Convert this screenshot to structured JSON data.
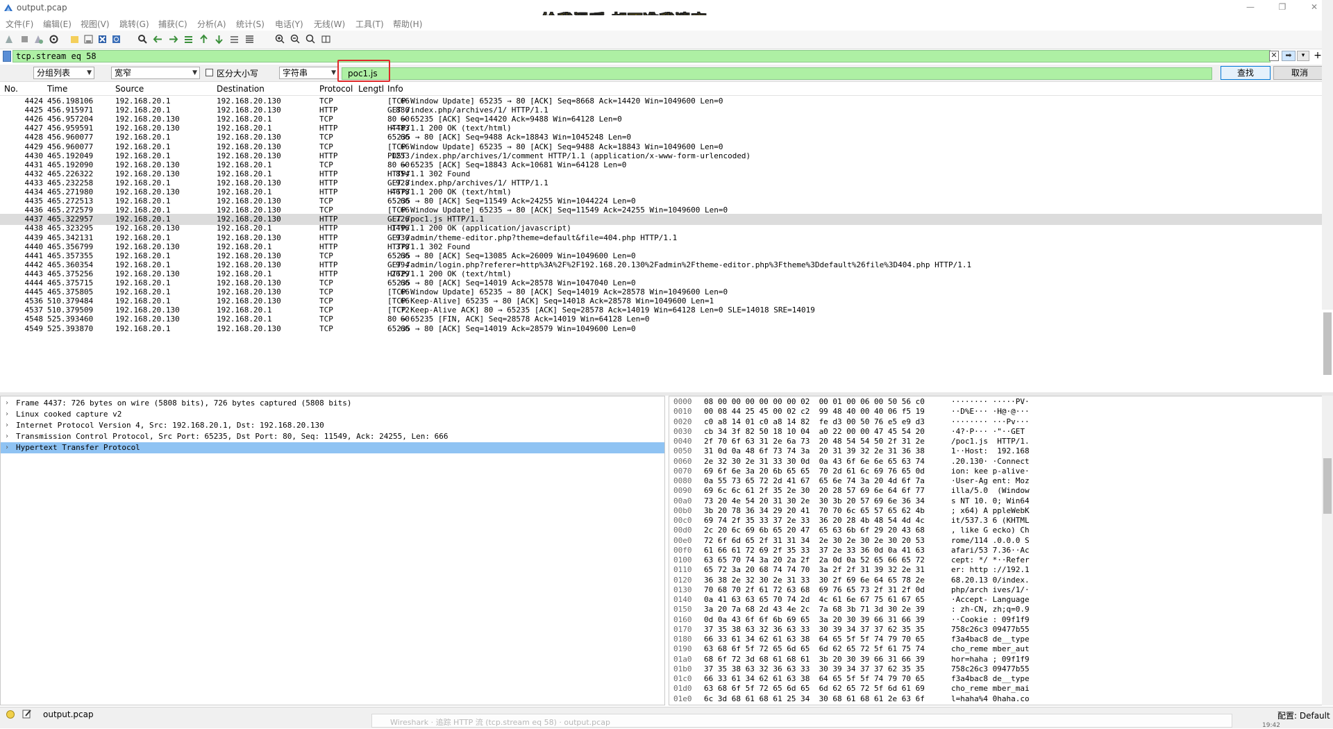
{
  "window": {
    "title": "output.pcap",
    "caption_overlay": "给我温暖 却不准我遗忘",
    "minimize": "—",
    "maximize": "❐",
    "close": "✕"
  },
  "menu": [
    "文件(F)",
    "编辑(E)",
    "视图(V)",
    "跳转(G)",
    "捕获(C)",
    "分析(A)",
    "统计(S)",
    "电话(Y)",
    "无线(W)",
    "工具(T)",
    "帮助(H)"
  ],
  "filter": {
    "value": "tcp.stream eq 58",
    "clear_label": "✕",
    "apply_label": "➡",
    "dropdown_label": "▾",
    "add_label": "+"
  },
  "find": {
    "scope": "分组列表",
    "width": "宽窄",
    "case_label": "区分大小写",
    "type": "字符串",
    "value": "poc1.js",
    "find_label": "查找",
    "cancel_label": "取消"
  },
  "columns": [
    "No.",
    "Time",
    "Source",
    "Destination",
    "Protocol",
    "Lengtl",
    "Info"
  ],
  "packets": [
    {
      "no": "4424",
      "time": "456.198106",
      "src": "192.168.20.1",
      "dst": "192.168.20.130",
      "proto": "TCP",
      "len": "66",
      "info": "[TCP Window Update] 65235 → 80 [ACK] Seq=8668 Ack=14420 Win=1049600 Len=0"
    },
    {
      "no": "4425",
      "time": "456.915971",
      "src": "192.168.20.1",
      "dst": "192.168.20.130",
      "proto": "HTTP",
      "len": "880",
      "info": "GET /index.php/archives/1/ HTTP/1.1"
    },
    {
      "no": "4426",
      "time": "456.957204",
      "src": "192.168.20.130",
      "dst": "192.168.20.1",
      "proto": "TCP",
      "len": "60",
      "info": "80 → 65235 [ACK] Seq=14420 Ack=9488 Win=64128 Len=0"
    },
    {
      "no": "4427",
      "time": "456.959591",
      "src": "192.168.20.130",
      "dst": "192.168.20.1",
      "proto": "HTTP",
      "len": "4483",
      "info": "HTTP/1.1 200 OK  (text/html)"
    },
    {
      "no": "4428",
      "time": "456.960077",
      "src": "192.168.20.1",
      "dst": "192.168.20.130",
      "proto": "TCP",
      "len": "66",
      "info": "65235 → 80 [ACK] Seq=9488 Ack=18843 Win=1045248 Len=0"
    },
    {
      "no": "4429",
      "time": "456.960077",
      "src": "192.168.20.1",
      "dst": "192.168.20.130",
      "proto": "TCP",
      "len": "66",
      "info": "[TCP Window Update] 65235 → 80 [ACK] Seq=9488 Ack=18843 Win=1049600 Len=0"
    },
    {
      "no": "4430",
      "time": "465.192049",
      "src": "192.168.20.1",
      "dst": "192.168.20.130",
      "proto": "HTTP",
      "len": "1253",
      "info": "POST /index.php/archives/1/comment HTTP/1.1  (application/x-www-form-urlencoded)"
    },
    {
      "no": "4431",
      "time": "465.192090",
      "src": "192.168.20.130",
      "dst": "192.168.20.1",
      "proto": "TCP",
      "len": "60",
      "info": "80 → 65235 [ACK] Seq=18843 Ack=10681 Win=64128 Len=0"
    },
    {
      "no": "4432",
      "time": "465.226322",
      "src": "192.168.20.130",
      "dst": "192.168.20.1",
      "proto": "HTTP",
      "len": "854",
      "info": "HTTP/1.1 302 Found"
    },
    {
      "no": "4433",
      "time": "465.232258",
      "src": "192.168.20.1",
      "dst": "192.168.20.130",
      "proto": "HTTP",
      "len": "928",
      "info": "GET /index.php/archives/1/ HTTP/1.1"
    },
    {
      "no": "4434",
      "time": "465.271980",
      "src": "192.168.20.130",
      "dst": "192.168.20.1",
      "proto": "HTTP",
      "len": "4678",
      "info": "HTTP/1.1 200 OK  (text/html)"
    },
    {
      "no": "4435",
      "time": "465.272513",
      "src": "192.168.20.1",
      "dst": "192.168.20.130",
      "proto": "TCP",
      "len": "66",
      "info": "65235 → 80 [ACK] Seq=11549 Ack=24255 Win=1044224 Len=0"
    },
    {
      "no": "4436",
      "time": "465.272579",
      "src": "192.168.20.1",
      "dst": "192.168.20.130",
      "proto": "TCP",
      "len": "66",
      "info": "[TCP Window Update] 65235 → 80 [ACK] Seq=11549 Ack=24255 Win=1049600 Len=0"
    },
    {
      "no": "4437",
      "time": "465.322957",
      "src": "192.168.20.1",
      "dst": "192.168.20.130",
      "proto": "HTTP",
      "len": "726",
      "info": "GET /poc1.js HTTP/1.1",
      "selected": true
    },
    {
      "no": "4438",
      "time": "465.323295",
      "src": "192.168.20.130",
      "dst": "192.168.20.1",
      "proto": "HTTP",
      "len": "1496",
      "info": "HTTP/1.1 200 OK  (application/javascript)"
    },
    {
      "no": "4439",
      "time": "465.342131",
      "src": "192.168.20.1",
      "dst": "192.168.20.130",
      "proto": "HTTP",
      "len": "930",
      "info": "GET /admin/theme-editor.php?theme=default&file=404.php HTTP/1.1"
    },
    {
      "no": "4440",
      "time": "465.356799",
      "src": "192.168.20.130",
      "dst": "192.168.20.1",
      "proto": "HTTP",
      "len": "378",
      "info": "HTTP/1.1 302 Found"
    },
    {
      "no": "4441",
      "time": "465.357355",
      "src": "192.168.20.1",
      "dst": "192.168.20.130",
      "proto": "TCP",
      "len": "66",
      "info": "65235 → 80 [ACK] Seq=13085 Ack=26009 Win=1049600 Len=0"
    },
    {
      "no": "4442",
      "time": "465.360354",
      "src": "192.168.20.1",
      "dst": "192.168.20.130",
      "proto": "HTTP",
      "len": "994",
      "info": "GET /admin/login.php?referer=http%3A%2F%2F192.168.20.130%2Fadmin%2Ftheme-editor.php%3Ftheme%3Ddefault%26file%3D404.php HTTP/1.1"
    },
    {
      "no": "4443",
      "time": "465.375256",
      "src": "192.168.20.130",
      "dst": "192.168.20.1",
      "proto": "HTTP",
      "len": "2629",
      "info": "HTTP/1.1 200 OK  (text/html)"
    },
    {
      "no": "4444",
      "time": "465.375715",
      "src": "192.168.20.1",
      "dst": "192.168.20.130",
      "proto": "TCP",
      "len": "66",
      "info": "65235 → 80 [ACK] Seq=14019 Ack=28578 Win=1047040 Len=0"
    },
    {
      "no": "4445",
      "time": "465.375805",
      "src": "192.168.20.1",
      "dst": "192.168.20.130",
      "proto": "TCP",
      "len": "66",
      "info": "[TCP Window Update] 65235 → 80 [ACK] Seq=14019 Ack=28578 Win=1049600 Len=0"
    },
    {
      "no": "4536",
      "time": "510.379484",
      "src": "192.168.20.1",
      "dst": "192.168.20.130",
      "proto": "TCP",
      "len": "66",
      "info": "[TCP Keep-Alive] 65235 → 80 [ACK] Seq=14018 Ack=28578 Win=1049600 Len=1"
    },
    {
      "no": "4537",
      "time": "510.379509",
      "src": "192.168.20.130",
      "dst": "192.168.20.1",
      "proto": "TCP",
      "len": "72",
      "info": "[TCP Keep-Alive ACK] 80 → 65235 [ACK] Seq=28578 Ack=14019 Win=64128 Len=0 SLE=14018 SRE=14019"
    },
    {
      "no": "4548",
      "time": "525.393460",
      "src": "192.168.20.130",
      "dst": "192.168.20.1",
      "proto": "TCP",
      "len": "60",
      "info": "80 → 65235 [FIN, ACK] Seq=28578 Ack=14019 Win=64128 Len=0"
    },
    {
      "no": "4549",
      "time": "525.393870",
      "src": "192.168.20.1",
      "dst": "192.168.20.130",
      "proto": "TCP",
      "len": "66",
      "info": "65235 → 80 [ACK] Seq=14019 Ack=28579 Win=1049600 Len=0"
    }
  ],
  "details": [
    {
      "text": "Frame 4437: 726 bytes on wire (5808 bits), 726 bytes captured (5808 bits)"
    },
    {
      "text": "Linux cooked capture v2"
    },
    {
      "text": "Internet Protocol Version 4, Src: 192.168.20.1, Dst: 192.168.20.130"
    },
    {
      "text": "Transmission Control Protocol, Src Port: 65235, Dst Port: 80, Seq: 11549, Ack: 24255, Len: 666"
    },
    {
      "text": "Hypertext Transfer Protocol",
      "selected": true
    }
  ],
  "bytes": [
    {
      "off": "0000",
      "hex": "08 00 00 00 00 00 00 02  00 01 00 06 00 50 56 c0",
      "ascii": "········ ·····PV·"
    },
    {
      "off": "0010",
      "hex": "00 08 44 25 45 00 02 c2  99 48 40 00 40 06 f5 19",
      "ascii": "··D%E··· ·H@·@···"
    },
    {
      "off": "0020",
      "hex": "c0 a8 14 01 c0 a8 14 82  fe d3 00 50 76 e5 e9 d3",
      "ascii": "········ ···Pv···"
    },
    {
      "off": "0030",
      "hex": "cb 34 3f 82 50 18 10 04  a0 22 00 00 47 45 54 20",
      "ascii": "·4?·P··· ·\"··GET "
    },
    {
      "off": "0040",
      "hex": "2f 70 6f 63 31 2e 6a 73  20 48 54 54 50 2f 31 2e",
      "ascii": "/poc1.js  HTTP/1."
    },
    {
      "off": "0050",
      "hex": "31 0d 0a 48 6f 73 74 3a  20 31 39 32 2e 31 36 38",
      "ascii": "1··Host:  192.168"
    },
    {
      "off": "0060",
      "hex": "2e 32 30 2e 31 33 30 0d  0a 43 6f 6e 6e 65 63 74",
      "ascii": ".20.130· ·Connect"
    },
    {
      "off": "0070",
      "hex": "69 6f 6e 3a 20 6b 65 65  70 2d 61 6c 69 76 65 0d",
      "ascii": "ion: kee p-alive·"
    },
    {
      "off": "0080",
      "hex": "0a 55 73 65 72 2d 41 67  65 6e 74 3a 20 4d 6f 7a",
      "ascii": "·User-Ag ent: Moz"
    },
    {
      "off": "0090",
      "hex": "69 6c 6c 61 2f 35 2e 30  20 28 57 69 6e 64 6f 77",
      "ascii": "illa/5.0  (Window"
    },
    {
      "off": "00a0",
      "hex": "73 20 4e 54 20 31 30 2e  30 3b 20 57 69 6e 36 34",
      "ascii": "s NT 10. 0; Win64"
    },
    {
      "off": "00b0",
      "hex": "3b 20 78 36 34 29 20 41  70 70 6c 65 57 65 62 4b",
      "ascii": "; x64) A ppleWebK"
    },
    {
      "off": "00c0",
      "hex": "69 74 2f 35 33 37 2e 33  36 20 28 4b 48 54 4d 4c",
      "ascii": "it/537.3 6 (KHTML"
    },
    {
      "off": "00d0",
      "hex": "2c 20 6c 69 6b 65 20 47  65 63 6b 6f 29 20 43 68",
      "ascii": ", like G ecko) Ch"
    },
    {
      "off": "00e0",
      "hex": "72 6f 6d 65 2f 31 31 34  2e 30 2e 30 2e 30 20 53",
      "ascii": "rome/114 .0.0.0 S"
    },
    {
      "off": "00f0",
      "hex": "61 66 61 72 69 2f 35 33  37 2e 33 36 0d 0a 41 63",
      "ascii": "afari/53 7.36··Ac"
    },
    {
      "off": "0100",
      "hex": "63 65 70 74 3a 20 2a 2f  2a 0d 0a 52 65 66 65 72",
      "ascii": "cept: */ *··Refer"
    },
    {
      "off": "0110",
      "hex": "65 72 3a 20 68 74 74 70  3a 2f 2f 31 39 32 2e 31",
      "ascii": "er: http ://192.1"
    },
    {
      "off": "0120",
      "hex": "36 38 2e 32 30 2e 31 33  30 2f 69 6e 64 65 78 2e",
      "ascii": "68.20.13 0/index."
    },
    {
      "off": "0130",
      "hex": "70 68 70 2f 61 72 63 68  69 76 65 73 2f 31 2f 0d",
      "ascii": "php/arch ives/1/·"
    },
    {
      "off": "0140",
      "hex": "0a 41 63 63 65 70 74 2d  4c 61 6e 67 75 61 67 65",
      "ascii": "·Accept- Language"
    },
    {
      "off": "0150",
      "hex": "3a 20 7a 68 2d 43 4e 2c  7a 68 3b 71 3d 30 2e 39",
      "ascii": ": zh-CN, zh;q=0.9"
    },
    {
      "off": "0160",
      "hex": "0d 0a 43 6f 6f 6b 69 65  3a 20 30 39 66 31 66 39",
      "ascii": "··Cookie : 09f1f9"
    },
    {
      "off": "0170",
      "hex": "37 35 38 63 32 36 63 33  30 39 34 37 37 62 35 35",
      "ascii": "758c26c3 09477b55"
    },
    {
      "off": "0180",
      "hex": "66 33 61 34 62 61 63 38  64 65 5f 5f 74 79 70 65",
      "ascii": "f3a4bac8 de__type"
    },
    {
      "off": "0190",
      "hex": "63 68 6f 5f 72 65 6d 65  6d 62 65 72 5f 61 75 74",
      "ascii": "cho_reme mber_aut"
    },
    {
      "off": "01a0",
      "hex": "68 6f 72 3d 68 61 68 61  3b 20 30 39 66 31 66 39",
      "ascii": "hor=haha ; 09f1f9"
    },
    {
      "off": "01b0",
      "hex": "37 35 38 63 32 36 63 33  30 39 34 37 37 62 35 35",
      "ascii": "758c26c3 09477b55"
    },
    {
      "off": "01c0",
      "hex": "66 33 61 34 62 61 63 38  64 65 5f 5f 74 79 70 65",
      "ascii": "f3a4bac8 de__type"
    },
    {
      "off": "01d0",
      "hex": "63 68 6f 5f 72 65 6d 65  6d 62 65 72 5f 6d 61 69",
      "ascii": "cho_reme mber_mai"
    },
    {
      "off": "01e0",
      "hex": "6c 3d 68 61 68 61 25 34  30 68 61 68 61 2e 63 6f",
      "ascii": "l=haha%4 0haha.co"
    }
  ],
  "status": {
    "file": "output.pcap",
    "profile": "配置: Default",
    "taskbar_ghost": "Wireshark · 追踪 HTTP 流 (tcp.stream eq 58) · output.pcap",
    "clock": "19:42"
  },
  "colors": {
    "filter_green": "#aef0a4",
    "selected_row": "#dcdcdc",
    "selected_detail": "#8fc3f3",
    "highlight_box": "#e02a2a",
    "caption": "#f5d700"
  }
}
